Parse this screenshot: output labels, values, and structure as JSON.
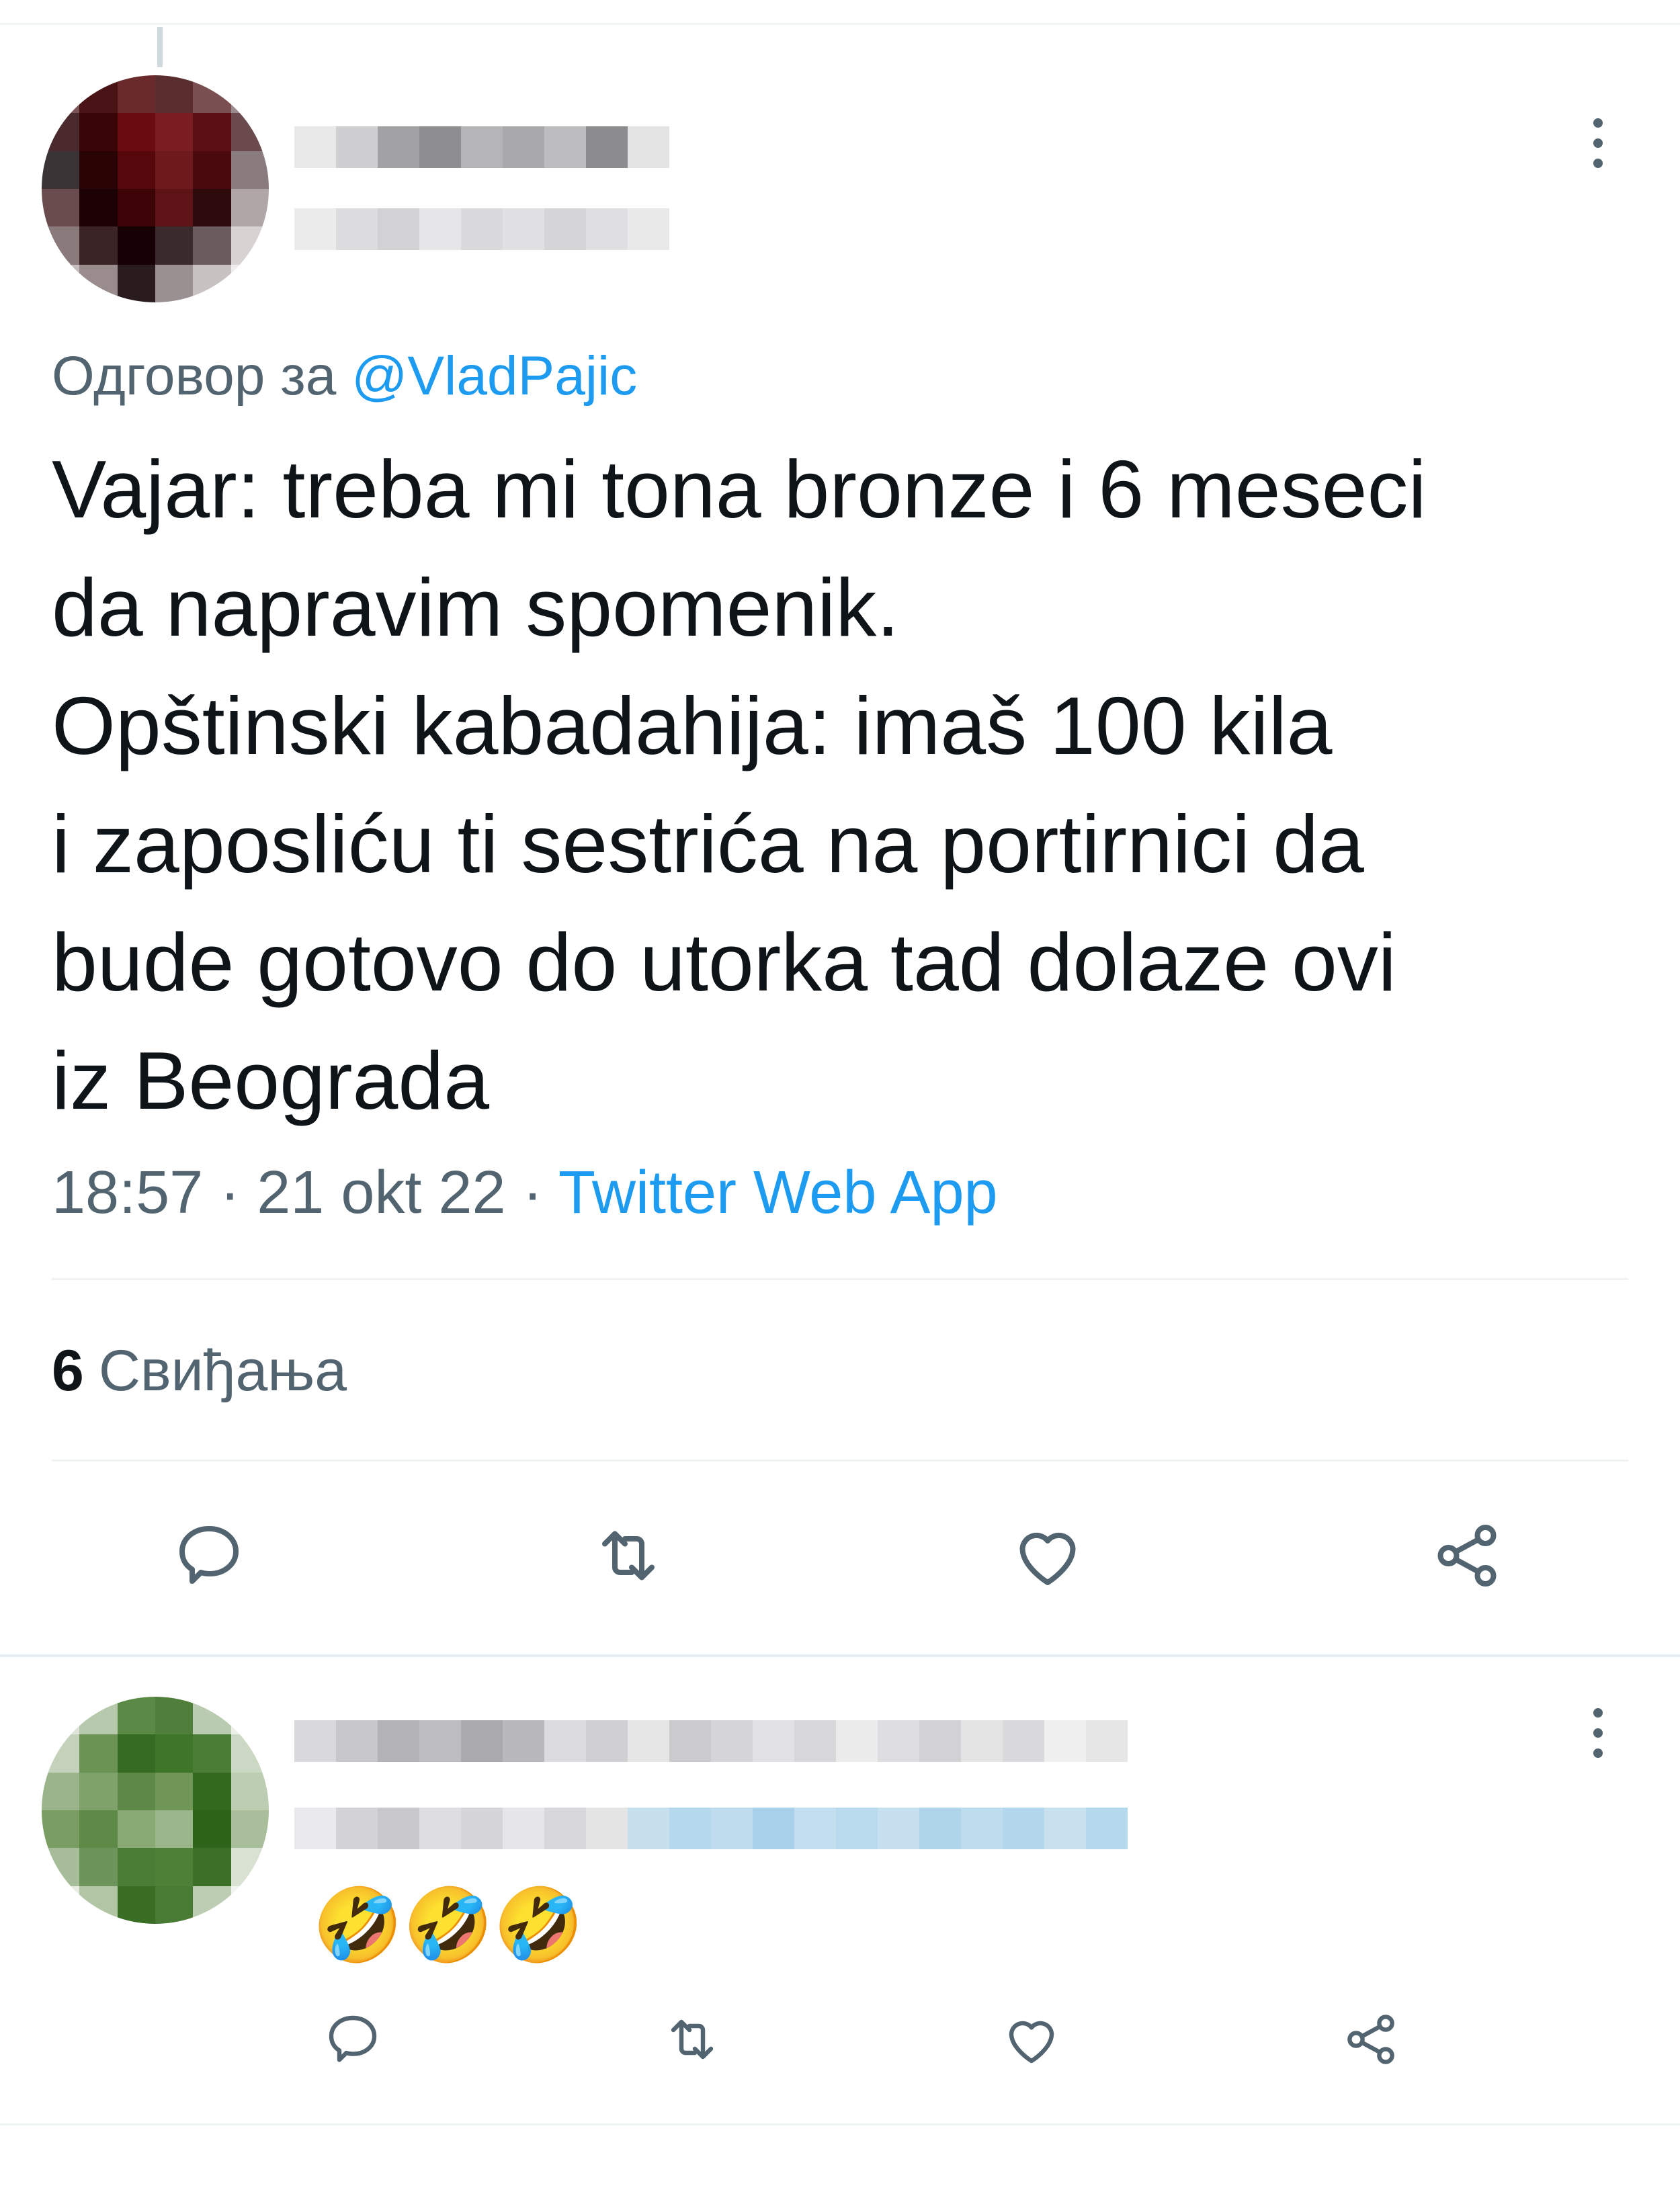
{
  "main_tweet": {
    "reply_prefix": "Одговор за",
    "reply_handle": "@VladPajic",
    "text_lines": [
      "Vajar: treba mi tona bronze i 6 meseci",
      "da napravim spomenik.",
      "Opštinski kabadahija: imaš 100 kila",
      "i zaposliću ti sestrića na portirnici da",
      "bude gotovo do utorka tad dolaze ovi",
      "iz Beograda"
    ],
    "time": "18:57",
    "date": "21 okt 22",
    "separator": "·",
    "source_app": "Twitter Web App",
    "likes_count": "6",
    "likes_label": "Свиђања",
    "actions": [
      "reply-icon",
      "retweet-icon",
      "like-icon",
      "share-icon"
    ]
  },
  "reply_tweet": {
    "text": "🤣🤣🤣",
    "actions": [
      "reply-icon",
      "retweet-icon",
      "like-icon",
      "share-icon"
    ]
  },
  "colors": {
    "text_primary": "#0f1419",
    "text_secondary": "#536471",
    "accent": "#1d9bf0",
    "divider": "#eff3f4"
  }
}
